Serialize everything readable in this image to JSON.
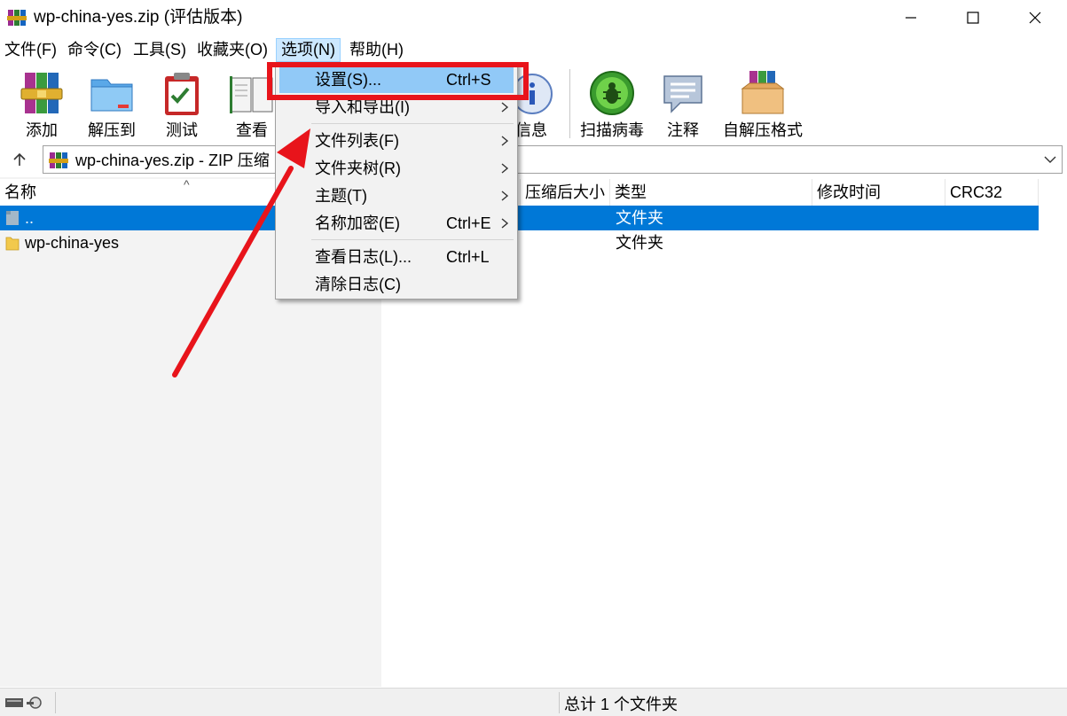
{
  "window": {
    "title": "wp-china-yes.zip (评估版本)"
  },
  "menu": {
    "items": [
      "文件(F)",
      "命令(C)",
      "工具(S)",
      "收藏夹(O)",
      "选项(N)",
      "帮助(H)"
    ]
  },
  "toolbar": {
    "add": "添加",
    "extract": "解压到",
    "test": "测试",
    "view": "查看",
    "info": "信息",
    "scan": "扫描病毒",
    "comment": "注释",
    "sfx": "自解压格式"
  },
  "address": {
    "path": "wp-china-yes.zip - ZIP 压缩"
  },
  "columns": {
    "name": "名称",
    "packed": "压缩后大小",
    "type": "类型",
    "modified": "修改时间",
    "crc": "CRC32"
  },
  "files": [
    {
      "name": "..",
      "type": "文件夹"
    },
    {
      "name": "wp-china-yes",
      "type": "文件夹"
    }
  ],
  "status": {
    "summary": "总计 1 个文件夹"
  },
  "dropdown": {
    "settings": {
      "label": "设置(S)...",
      "shortcut": "Ctrl+S"
    },
    "import_export": {
      "label": "导入和导出(I)"
    },
    "file_list": {
      "label": "文件列表(F)"
    },
    "folder_tree": {
      "label": "文件夹树(R)"
    },
    "theme": {
      "label": "主题(T)"
    },
    "name_encrypt": {
      "label": "名称加密(E)",
      "shortcut": "Ctrl+E"
    },
    "view_log": {
      "label": "查看日志(L)...",
      "shortcut": "Ctrl+L"
    },
    "clear_log": {
      "label": "清除日志(C)"
    }
  },
  "colors": {
    "selection": "#0078d7",
    "menu_highlight": "#91c9f7",
    "annotation": "#e8141b"
  }
}
